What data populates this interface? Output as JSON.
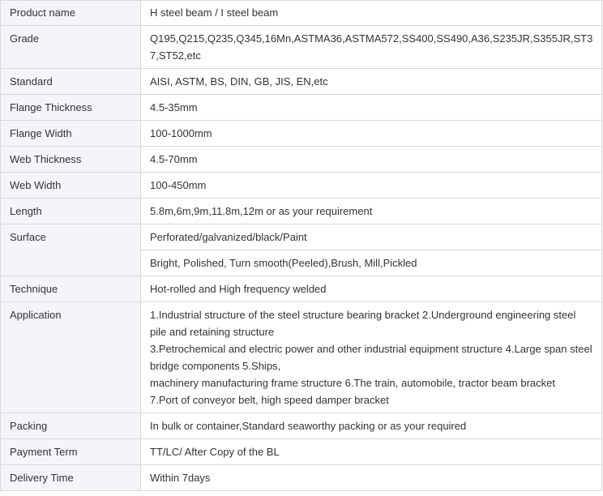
{
  "rows": [
    {
      "label": "Product name",
      "values": [
        "H steel beam / I steel beam"
      ]
    },
    {
      "label": "Grade",
      "values": [
        "Q195,Q215,Q235,Q345,16Mn,ASTMA36,ASTMA572,SS400,SS490,A36,S235JR,S355JR,ST37,ST52,etc"
      ]
    },
    {
      "label": "Standard",
      "values": [
        "AISI, ASTM, BS, DIN, GB, JIS, EN,etc"
      ]
    },
    {
      "label": "Flange Thickness",
      "values": [
        "4.5-35mm"
      ]
    },
    {
      "label": "Flange Width",
      "values": [
        "100-1000mm"
      ]
    },
    {
      "label": "Web Thickness",
      "values": [
        "4.5-70mm"
      ]
    },
    {
      "label": "Web Width",
      "values": [
        "100-450mm"
      ]
    },
    {
      "label": "Length",
      "values": [
        "5.8m,6m,9m,11.8m,12m or as your requirement"
      ]
    },
    {
      "label": "Surface",
      "values": [
        "Perforated/galvanized/black/Paint",
        "Bright, Polished, Turn smooth(Peeled),Brush, Mill,Pickled"
      ]
    },
    {
      "label": "Technique",
      "values": [
        "Hot-rolled and High frequency welded"
      ]
    },
    {
      "label": "Application",
      "values": [
        "1.Industrial structure of the steel structure bearing bracket 2.Underground engineering steel pile and retaining structure",
        "3.Petrochemical and electric power and other industrial equipment structure 4.Large span steel bridge components 5.Ships,",
        "machinery manufacturing frame structure 6.The train, automobile, tractor beam bracket",
        "7.Port of conveyor belt, high speed damper bracket"
      ]
    },
    {
      "label": "Packing",
      "values": [
        "In bulk or container,Standard seaworthy packing or as your required"
      ]
    },
    {
      "label": "Payment Term",
      "values": [
        "TT/LC/ After Copy of the BL"
      ]
    },
    {
      "label": "Delivery Time",
      "values": [
        "Within 7days"
      ]
    }
  ],
  "colors": {
    "label_bg": "#f3f5f8",
    "border": "#d9d9d9",
    "text": "#333333"
  }
}
